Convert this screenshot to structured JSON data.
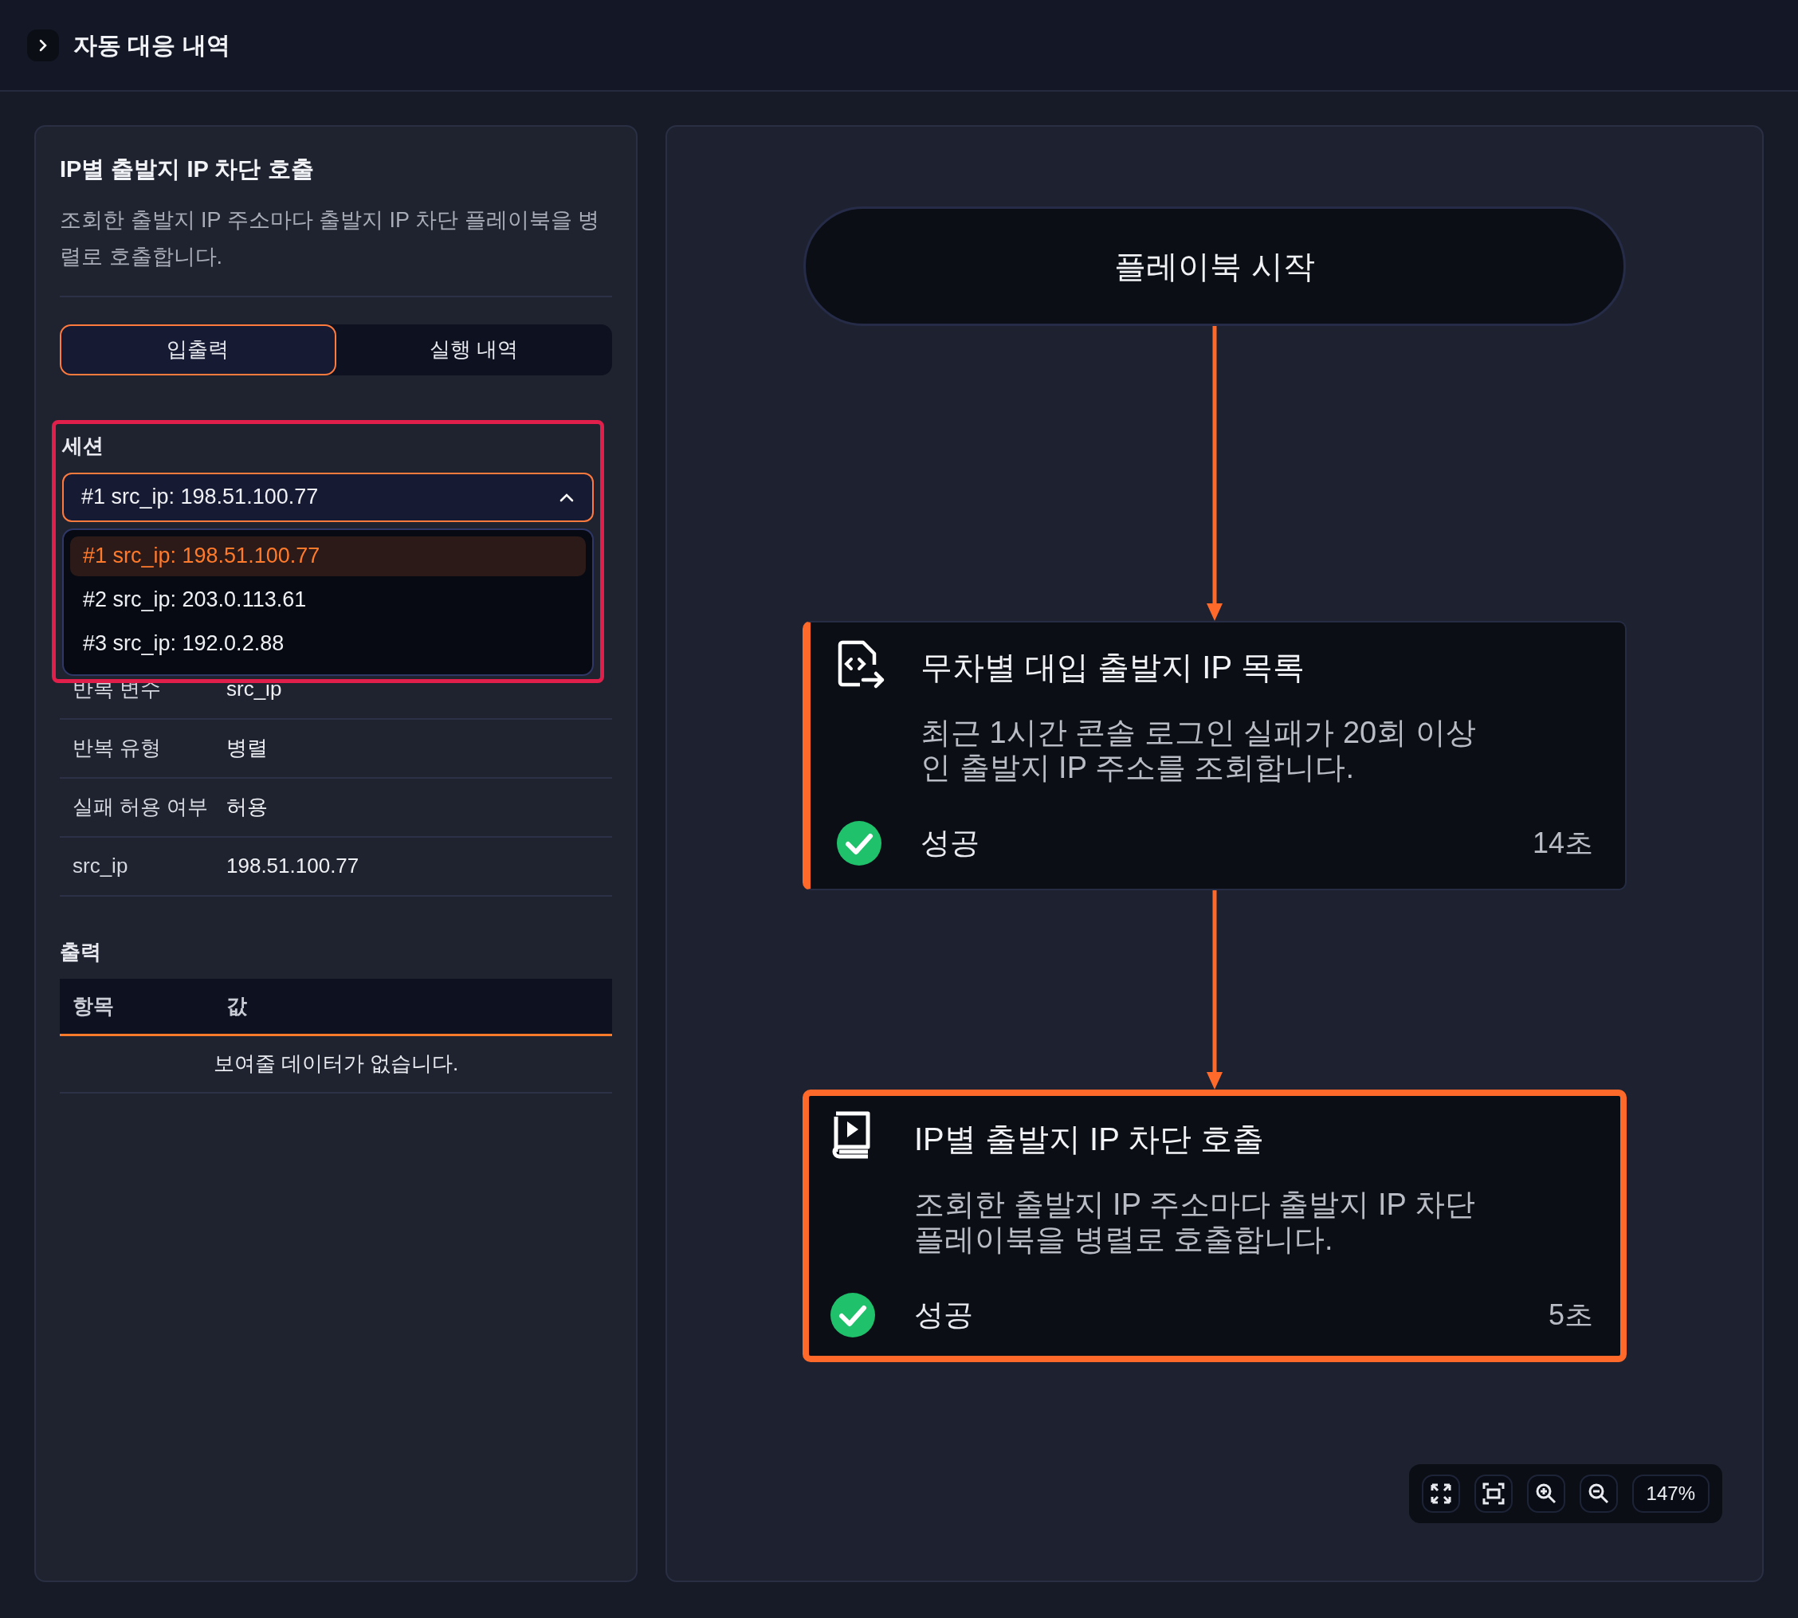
{
  "header": {
    "title": "자동 대응 내역"
  },
  "panel": {
    "title": "IP별 출발지 IP 차단 호출",
    "description": "조회한 출발지 IP 주소마다 출발지 IP 차단 플레이북을 병렬로 호출합니다."
  },
  "tabs": [
    {
      "label": "입출력",
      "selected": true
    },
    {
      "label": "실행 내역",
      "selected": false
    }
  ],
  "session": {
    "label": "세션",
    "value": "#1 src_ip: 198.51.100.77",
    "expanded": true,
    "options": [
      {
        "label": "#1 src_ip: 198.51.100.77",
        "selected": true
      },
      {
        "label": "#2 src_ip: 203.0.113.61",
        "selected": false
      },
      {
        "label": "#3 src_ip: 192.0.2.88",
        "selected": false
      }
    ]
  },
  "input_rows": [
    {
      "key": "반복 변수",
      "value": "src_ip"
    },
    {
      "key": "반복 유형",
      "value": "병렬"
    },
    {
      "key": "실패 허용 여부",
      "value": "허용"
    },
    {
      "key": "src_ip",
      "value": "198.51.100.77"
    }
  ],
  "output": {
    "label": "출력",
    "columns": [
      "항목",
      "값"
    ],
    "empty_text": "보여줄 데이터가 없습니다."
  },
  "flow": {
    "start": "플레이북 시작",
    "nodes": [
      {
        "kind": "code",
        "title": "무차별 대입 출발지 IP 목록",
        "description": "최근 1시간 콘솔 로그인 실패가 20회 이상인 출발지 IP 주소를 조회합니다.",
        "status": "성공",
        "success": true,
        "duration": "14초",
        "selected": false
      },
      {
        "kind": "playbook",
        "title": "IP별 출발지 IP 차단 호출",
        "description": "조회한 출발지 IP 주소마다 출발지 IP 차단 플레이북을 병렬로 호출합니다.",
        "status": "성공",
        "success": true,
        "duration": "5초",
        "selected": true
      }
    ]
  },
  "zoom_controls": {
    "zoom": "147%"
  }
}
